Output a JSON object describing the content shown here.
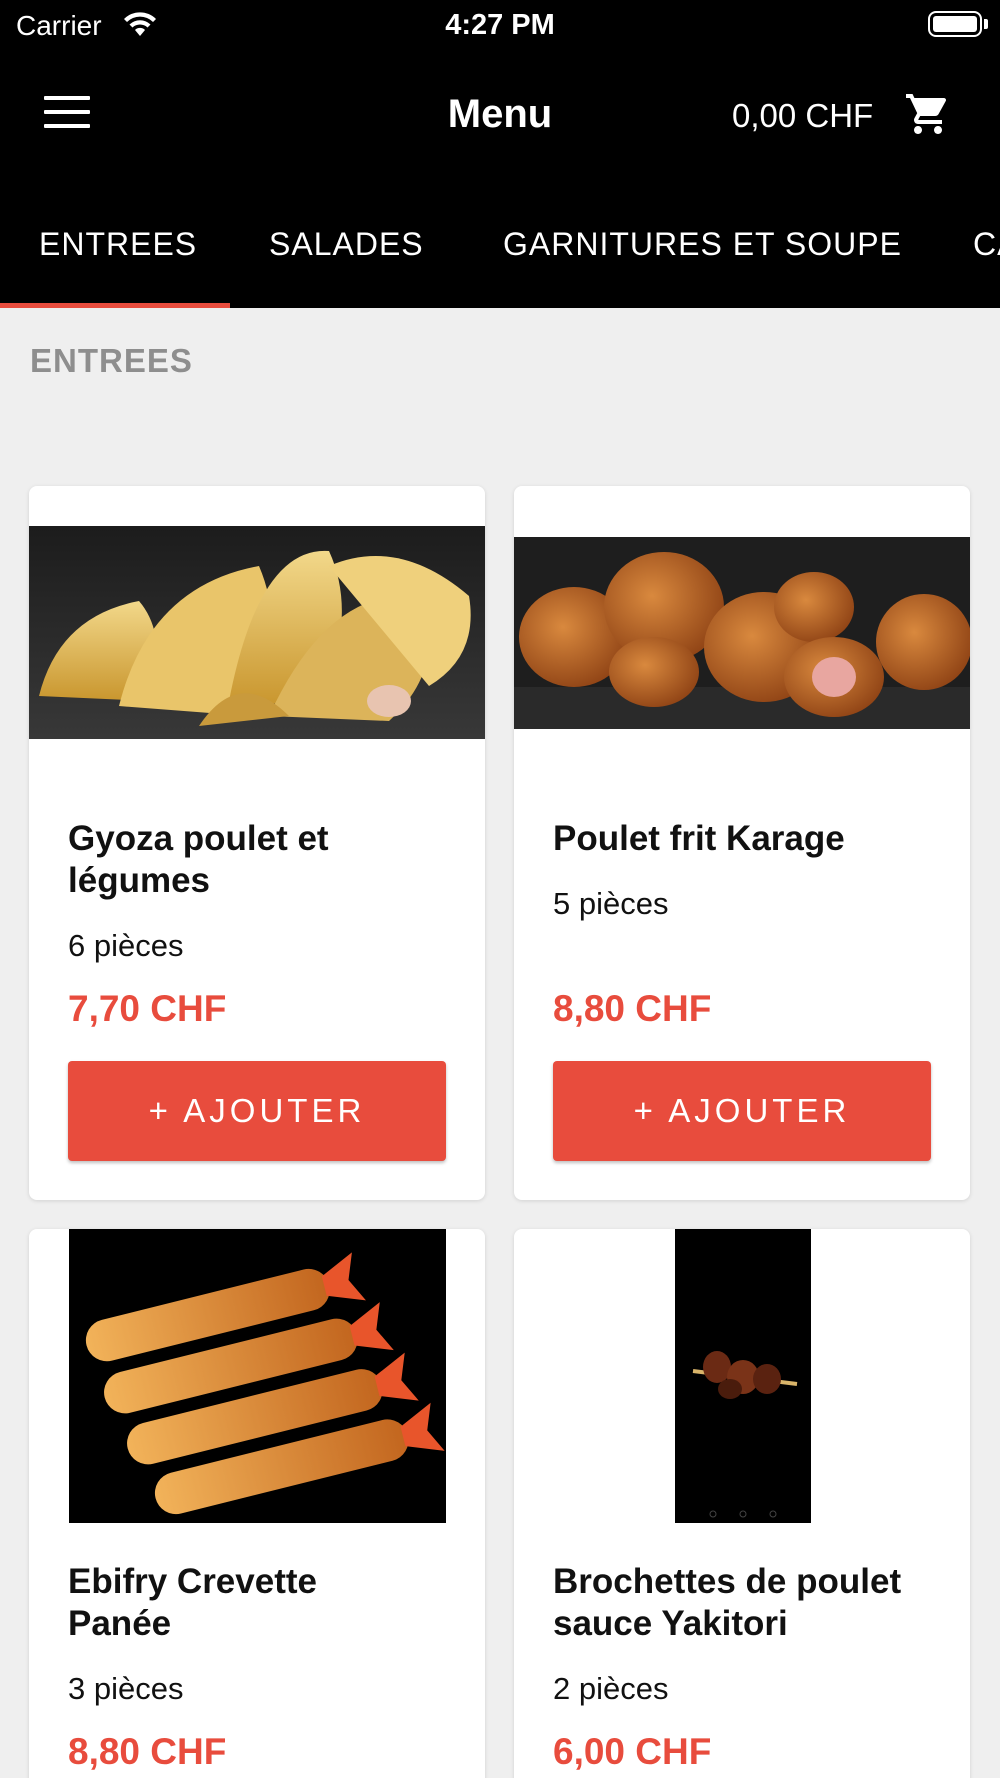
{
  "status_bar": {
    "carrier": "Carrier",
    "time": "4:27 PM",
    "icons": [
      "wifi-icon",
      "battery-icon"
    ]
  },
  "app_bar": {
    "menu_icon": "hamburger-icon",
    "title": "Menu",
    "cart_total": "0,00 CHF",
    "cart_icon": "shopping-cart-icon"
  },
  "tabs": [
    {
      "label": "ENTREES",
      "selected": true
    },
    {
      "label": "SALADES",
      "selected": false
    },
    {
      "label": "GARNITURES ET SOUPE",
      "selected": false
    },
    {
      "label": "CA",
      "selected": false
    }
  ],
  "colors": {
    "accent": "#e84c3d",
    "header_bg": "#000000",
    "page_bg": "#efefef",
    "section_heading": "#8e8e8e"
  },
  "section": {
    "heading": "ENTREES"
  },
  "products": [
    {
      "name_line1": "Gyoza poulet et",
      "name_line2": "légumes",
      "description": "6 pièces",
      "price": "7,70 CHF",
      "button_label": "+ AJOUTER"
    },
    {
      "name_line1": "Poulet frit Karage",
      "name_line2": "",
      "description": "5 pièces",
      "price": "8,80 CHF",
      "button_label": "+ AJOUTER"
    },
    {
      "name_line1": "Ebifry Crevette",
      "name_line2": "Panée",
      "description": "3 pièces",
      "price": "8,80 CHF"
    },
    {
      "name_line1": "Brochettes de poulet",
      "name_line2": "sauce Yakitori",
      "description": "2 pièces",
      "price": "6,00 CHF"
    }
  ]
}
